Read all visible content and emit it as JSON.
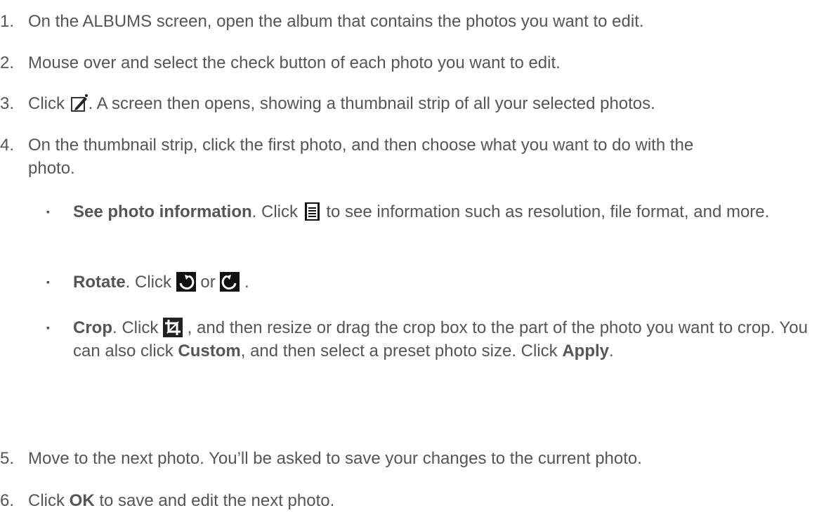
{
  "steps": [
    {
      "num": "1.",
      "text": "On the ALBUMS screen, open the album that contains the photos you want to edit."
    },
    {
      "num": "2.",
      "text": "Mouse over and select the check button of each photo you want to edit."
    },
    {
      "num": "3.",
      "pre": "Click ",
      "icon": "edit-icon",
      "post": ". A screen then opens, showing a thumbnail strip of all your selected photos."
    },
    {
      "num": "4.",
      "text": "On the thumbnail strip, click the first photo, and then choose what you want to do with the photo."
    },
    {
      "num": "5.",
      "text": "Move to the next photo. You’ll be asked to save your changes to the current photo."
    },
    {
      "num": "6.",
      "pre": "Click ",
      "bold": "OK",
      "post": " to save and edit the next photo."
    }
  ],
  "substeps": [
    {
      "bullet": "▪",
      "bold": "See photo information",
      "mid": ". Click ",
      "icon": "document-info-icon",
      "post": " to see information such as resolution, file format, and more."
    },
    {
      "bullet": "▪",
      "bold": "Rotate",
      "mid": ". Click ",
      "icon1": "rotate-clockwise-icon",
      "between": " or ",
      "icon2": "rotate-counterclockwise-icon",
      "post": " ."
    },
    {
      "bullet": "▪",
      "bold": "Crop",
      "mid": ". Click ",
      "icon": "crop-icon",
      "post": " , and then resize or drag the crop box to the part of the photo you want to crop. You can also click ",
      "bold2": "Custom",
      "post2": ", and then select a preset photo size. Click ",
      "bold3": "Apply",
      "post3": "."
    }
  ]
}
